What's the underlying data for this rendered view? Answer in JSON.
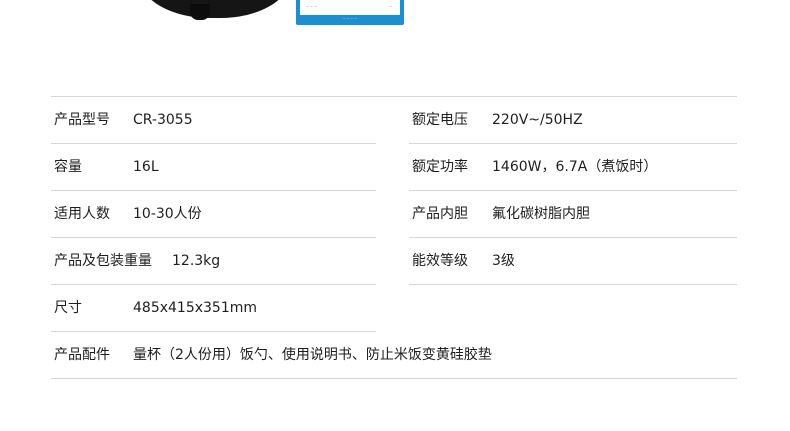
{
  "specs": {
    "rows": [
      {
        "label": "产品型号",
        "value": "CR-3055"
      },
      {
        "label": "额定电压",
        "value": "220V~/50HZ"
      },
      {
        "label": "容量",
        "value": "16L"
      },
      {
        "label": "额定功率",
        "value": "1460W，6.7A（煮饭时）"
      },
      {
        "label": "适用人数",
        "value": "10-30人份"
      },
      {
        "label": "产品内胆",
        "value": "氟化碳树脂内胆"
      },
      {
        "label": "产品及包装重量",
        "value": "12.3kg"
      },
      {
        "label": "能效等级",
        "value": "3级"
      },
      {
        "label": "尺寸",
        "value": "485x415x351mm"
      },
      {
        "label": "产品配件",
        "value": "量杯（2人份用）饭勺、使用说明书、防止米饭变黄硅胶垫"
      }
    ]
  },
  "colors": {
    "energy_label_blue": "#1a8fd4",
    "cooker_black": "#151515",
    "rule_gray": "#d6d6d6"
  }
}
